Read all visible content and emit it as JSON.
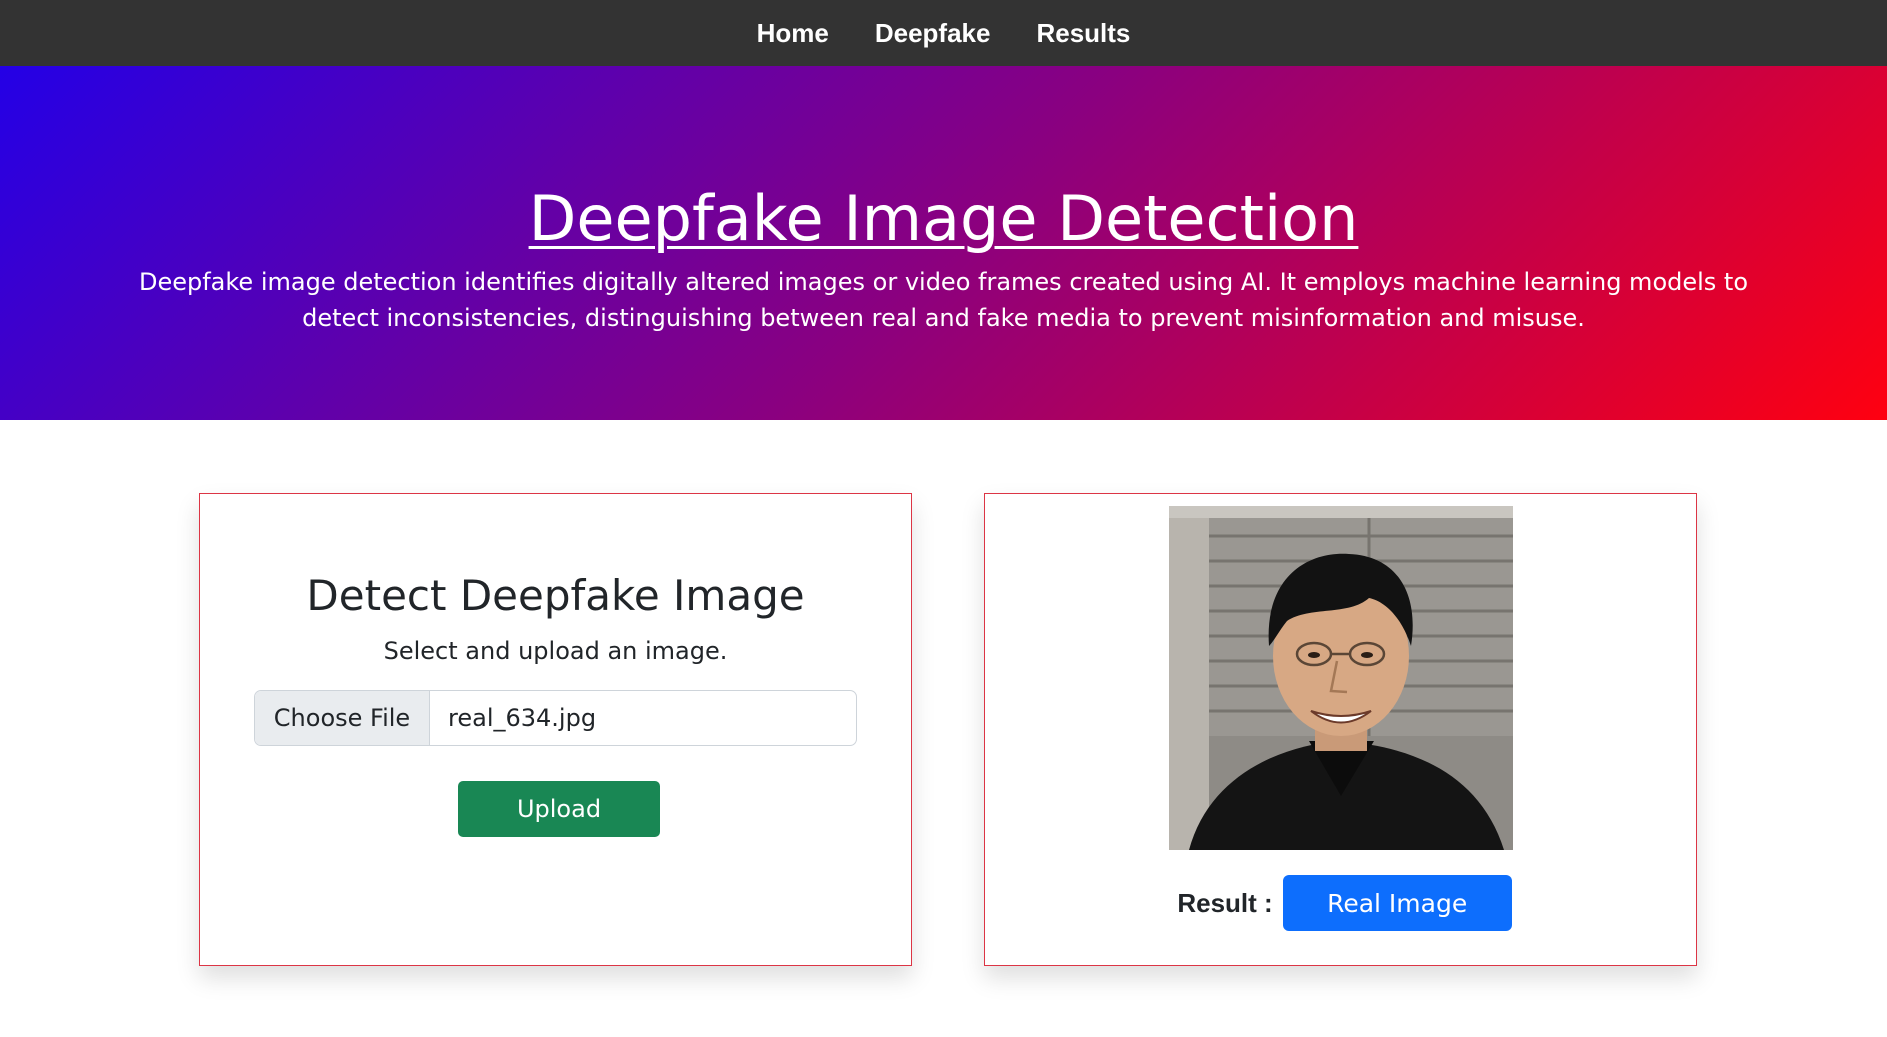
{
  "nav": {
    "items": [
      {
        "label": "Home"
      },
      {
        "label": "Deepfake"
      },
      {
        "label": "Results"
      }
    ]
  },
  "hero": {
    "title": "Deepfake Image Detection",
    "description": "Deepfake image detection identifies digitally altered images or video frames created using AI. It employs machine learning models to detect inconsistencies, distinguishing between real and fake media to prevent misinformation and misuse."
  },
  "upload_card": {
    "title": "Detect Deepfake Image",
    "subtitle": "Select and upload an image.",
    "choose_file_label": "Choose File",
    "file_name": "real_634.jpg",
    "upload_label": "Upload"
  },
  "result_card": {
    "image_description": "portrait-photo",
    "result_label": "Result :",
    "result_value": "Real Image"
  },
  "colors": {
    "navbar": "#333333",
    "gradient_start": "#2400e6",
    "gradient_end": "#ff0010",
    "card_border": "#dc3545",
    "upload_button": "#198754",
    "result_button": "#0d6efd"
  }
}
